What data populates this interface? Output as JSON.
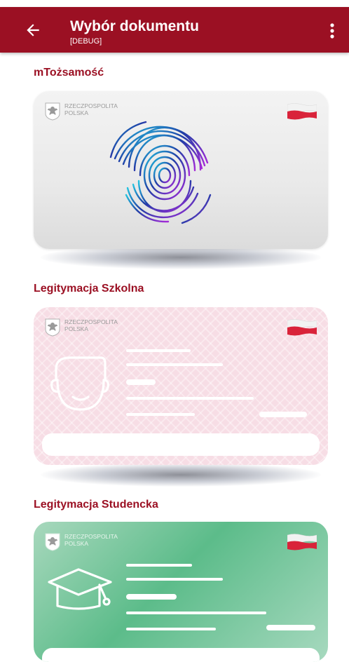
{
  "appbar": {
    "title": "Wybór dokumentu",
    "subtitle": "[DEBUG]",
    "back_icon": "arrow-back-icon",
    "menu_icon": "more-vert-icon",
    "color": "#9b1023"
  },
  "documents": [
    {
      "label": "mTożsamość",
      "issuer_line1": "RZECZPOSPOLITA",
      "issuer_line2": "POLSKA",
      "card_color": "#ececec"
    },
    {
      "label": "Legitymacja Szkolna",
      "issuer_line1": "RZECZPOSPOLITA",
      "issuer_line2": "POLSKA",
      "card_color": "#f7dde5"
    },
    {
      "label": "Legitymacja Studencka",
      "issuer_line1": "RZECZPOSPOLITA",
      "issuer_line2": "POLSKA",
      "card_color": "#5cbc8a"
    }
  ]
}
